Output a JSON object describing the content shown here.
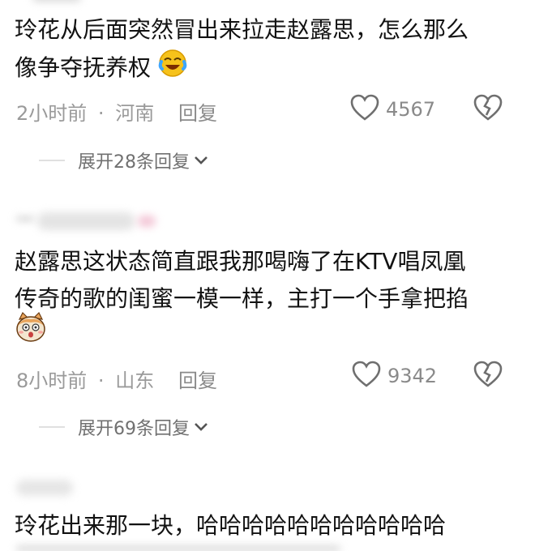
{
  "comments": [
    {
      "text_line1": "玲花从后面突然冒出来拉走赵露思，怎么那么",
      "text_line2": "像争夺抚养权",
      "emoji": "laughing-tears-emoji",
      "time": "2小时前",
      "dot": "·",
      "location": "河南",
      "reply_label": "回复",
      "likes": "4567",
      "expand_label": "展开28条回复"
    },
    {
      "text_line1": "赵露思这状态简直跟我那喝嗨了在KTV唱凤凰",
      "text_line2": "传奇的歌的闺蜜一模一样，主打一个手拿把掐",
      "emoji": "shocked-dog-emoji",
      "time": "8小时前",
      "dot": "·",
      "location": "山东",
      "reply_label": "回复",
      "likes": "9342",
      "expand_label": "展开69条回复"
    },
    {
      "text_line1": "玲花出来那一块，哈哈哈哈哈哈哈哈哈哈哈"
    }
  ],
  "colors": {
    "text": "#121212",
    "meta": "#9a9a9a",
    "icon": "#8a8a8a"
  }
}
